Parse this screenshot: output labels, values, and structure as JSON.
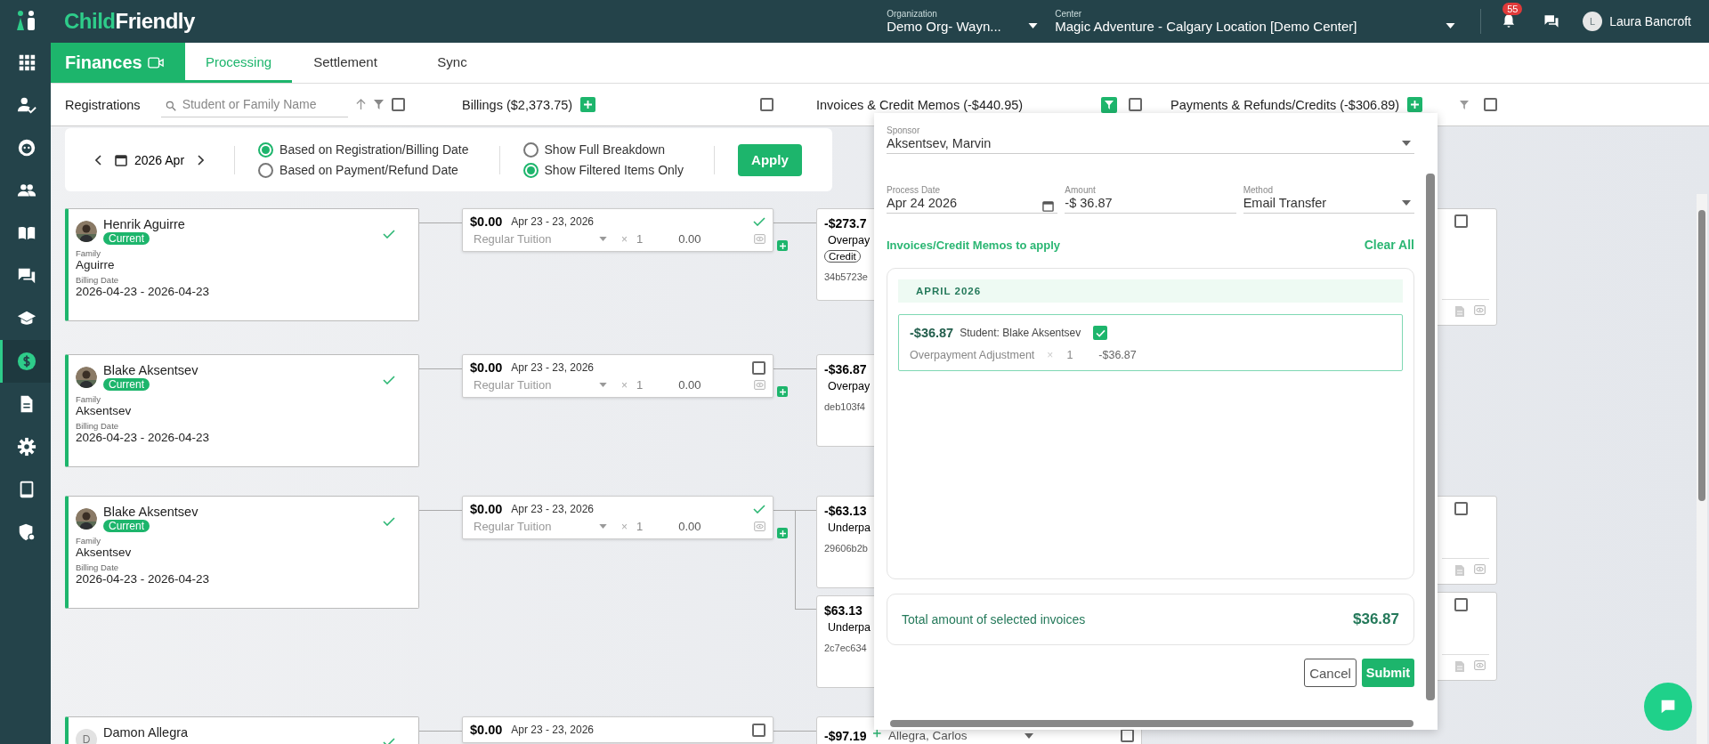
{
  "logo": [
    "Child",
    "Friendly"
  ],
  "header": {
    "organization_label": "Organization",
    "organization": "Demo Org- Wayn...",
    "center_label": "Center",
    "center": "Magic Adventure - Calgary Location [Demo Center]",
    "notifications": "55",
    "user_initial": "L",
    "user": "Laura Bancroft"
  },
  "sidebar": {
    "items": [
      {
        "selected": false
      },
      {
        "selected": false
      },
      {
        "selected": false
      },
      {
        "selected": false
      },
      {
        "selected": false
      },
      {
        "selected": false
      },
      {
        "selected": false
      },
      {
        "selected": true
      },
      {
        "selected": false
      },
      {
        "selected": false
      },
      {
        "selected": false
      },
      {
        "selected": false
      }
    ]
  },
  "module": {
    "title": "Finances"
  },
  "tabs": [
    {
      "label": "Processing",
      "selected": true
    },
    {
      "label": "Settlement",
      "selected": false
    },
    {
      "label": "Sync",
      "selected": false
    }
  ],
  "columns": {
    "registrations": {
      "title": "Registrations",
      "search_placeholder": "Student or Family Name",
      "checked": false
    },
    "billings": {
      "title": "Billings ($2,373.75)",
      "checked": false
    },
    "invoices": {
      "title": "Invoices & Credit Memos (-$440.95)",
      "filter_active": true,
      "checked": false
    },
    "payments": {
      "title": "Payments & Refunds/Credits (-$306.89)",
      "filter_active": false,
      "checked": false
    }
  },
  "filters": {
    "period": "2026 Apr",
    "date_basis": [
      {
        "label": "Based on Registration/Billing Date",
        "selected": true
      },
      {
        "label": "Based on Payment/Refund Date",
        "selected": false
      }
    ],
    "display": [
      {
        "label": "Show Full Breakdown",
        "selected": false
      },
      {
        "label": "Show Filtered Items Only",
        "selected": true
      }
    ],
    "apply": "Apply"
  },
  "rows": [
    {
      "registration": {
        "name": "Henrik Aguirre",
        "status": "Current",
        "family_label": "Family",
        "family": "Aguirre",
        "date_label": "Billing Date",
        "dates": "2026-04-23 - 2026-04-23",
        "verified": true
      },
      "billing": {
        "amount": "$0.00",
        "dates": "Apr 23 - 23, 2026",
        "item": "Regular Tuition",
        "times": "×",
        "quantity": "1",
        "total": "0.00",
        "verified": true
      },
      "invoices": [
        {
          "kind": "memo",
          "amount": "-$273.7",
          "description": "Overpay",
          "tag": "Credit",
          "ref": "34b5723e"
        }
      ],
      "payments": [
        {
          "checked": false
        }
      ]
    },
    {
      "registration": {
        "name": "Blake Aksentsev",
        "status": "Current",
        "family_label": "Family",
        "family": "Aksentsev",
        "date_label": "Billing Date",
        "dates": "2026-04-23 - 2026-04-23",
        "verified": true
      },
      "billing": {
        "amount": "$0.00",
        "dates": "Apr 23 - 23, 2026",
        "item": "Regular Tuition",
        "times": "×",
        "quantity": "1",
        "total": "0.00",
        "verified": false
      },
      "invoices": [
        {
          "kind": "memo",
          "amount": "-$36.87",
          "description": "Overpay",
          "ref": "deb103f4"
        }
      ],
      "payments": []
    },
    {
      "registration": {
        "name": "Blake Aksentsev",
        "status": "Current",
        "family_label": "Family",
        "family": "Aksentsev",
        "date_label": "Billing Date",
        "dates": "2026-04-23 - 2026-04-23",
        "verified": true
      },
      "billing": {
        "amount": "$0.00",
        "dates": "Apr 23 - 23, 2026",
        "item": "Regular Tuition",
        "times": "×",
        "quantity": "1",
        "total": "0.00",
        "verified": true
      },
      "invoices": [
        {
          "kind": "memo",
          "amount": "-$63.13",
          "description": "Underpa",
          "ref": "29606b2b"
        },
        {
          "kind": "memo",
          "amount": "$63.13",
          "description": "Underpa",
          "ref": "2c7ec634"
        }
      ],
      "payments": [
        {
          "checked": false
        },
        {
          "checked": false
        }
      ]
    },
    {
      "registration": {
        "name": "Damon Allegra",
        "kind": "initial",
        "initial": "D",
        "verified": true
      },
      "billing": {
        "amount": "$0.00",
        "dates": "Apr 23 - 23, 2026",
        "verified": false
      },
      "invoices": [
        {
          "kind": "sponsor",
          "amount": "-$97.19",
          "sponsor": "Allegra, Carlos",
          "checked": false
        }
      ],
      "payments": []
    }
  ],
  "panel": {
    "sponsor_label": "Sponsor",
    "sponsor": "Aksentsev, Marvin",
    "process_date_label": "Process Date",
    "process_date": "Apr 24 2026",
    "amount_label": "Amount",
    "amount": "-$ 36.87",
    "method_label": "Method",
    "method": "Email Transfer",
    "apply_title": "Invoices/Credit Memos to apply",
    "clear_all": "Clear All",
    "groups": [
      {
        "month": "APRIL 2026",
        "items": [
          {
            "amount": "-$36.87",
            "student": "Student: Blake Aksentsev",
            "description": "Overpayment Adjustment",
            "times": "×",
            "quantity": "1",
            "total": "-$36.87",
            "checked": true
          }
        ]
      }
    ],
    "total_label": "Total amount of selected invoices",
    "total": "$36.87",
    "cancel": "Cancel",
    "submit": "Submit"
  }
}
